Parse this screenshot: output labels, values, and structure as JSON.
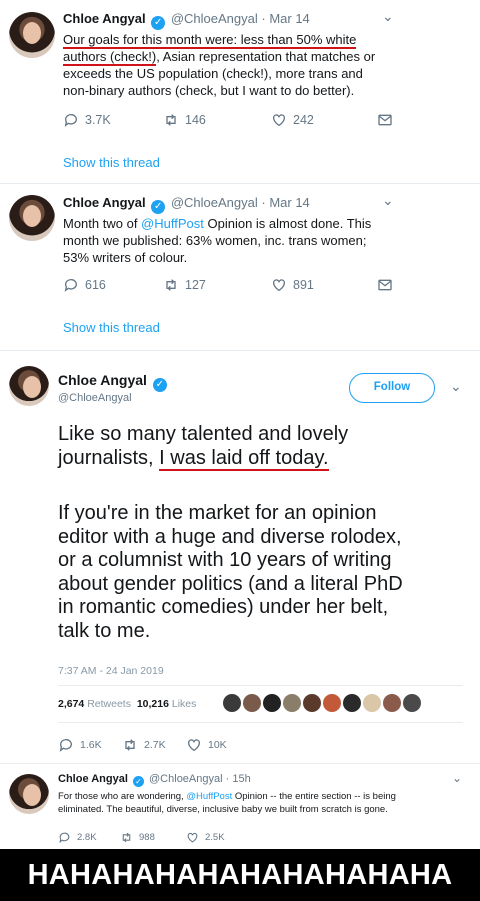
{
  "tweet1": {
    "name": "Chloe Angyal",
    "handle": "@ChloeAngyal",
    "date": "· Mar 14",
    "line1": "Our goals for this month were: less than 50% white",
    "line2a": "authors (check!)",
    "line2b": ", Asian representation that matches or",
    "line3": "exceeds the US population (check!), more trans and",
    "line4": "non-binary authors (check, but I want to do better).",
    "replies": "3.7K",
    "retweets": "146",
    "likes": "242",
    "show_thread": "Show this thread"
  },
  "tweet2": {
    "name": "Chloe Angyal",
    "handle": "@ChloeAngyal",
    "date": "· Mar 14",
    "line1a": "Month two of ",
    "mention": "@HuffPost",
    "line1b": " Opinion is almost done. This",
    "line2": "month we published: 63% women, inc. trans women;",
    "line3": "53% writers of colour.",
    "replies": "616",
    "retweets": "127",
    "likes": "891",
    "show_thread": "Show this thread"
  },
  "tweet3": {
    "name": "Chloe Angyal",
    "handle": "@ChloeAngyal",
    "follow_label": "Follow",
    "line1": "Like so many talented and lovely",
    "line2a": "journalists, ",
    "line2b": "I was laid off today.",
    "para2_1": "If you're in the market for an opinion",
    "para2_2": "editor with a huge and diverse rolodex,",
    "para2_3": "or a columnist with 10 years of writing",
    "para2_4": "about gender politics (and a literal PhD",
    "para2_5": "in romantic comedies) under her belt,",
    "para2_6": "talk to me.",
    "timestamp": "7:37 AM - 24 Jan 2019",
    "retweets_count": "2,674",
    "retweets_label": "Retweets",
    "likes_count": "10,216",
    "likes_label": "Likes",
    "replies": "1.6K",
    "retweets": "2.7K",
    "likes": "10K"
  },
  "tweet4": {
    "name": "Chloe Angyal",
    "handle": "@ChloeAngyal",
    "date": "· 15h",
    "line1a": "For those who are wondering, ",
    "mention": "@HuffPost",
    "line1b": " Opinion -- the entire section -- is being",
    "line2": "eliminated. The beautiful, diverse, inclusive baby we built from scratch is gone.",
    "replies": "2.8K",
    "retweets": "988",
    "likes": "2.5K"
  },
  "banner": "HAHAHAHAHAHAHAHAHAHA",
  "colors": {
    "accent": "#1da1f2",
    "underline": "#d0121b",
    "muted": "#657786"
  }
}
